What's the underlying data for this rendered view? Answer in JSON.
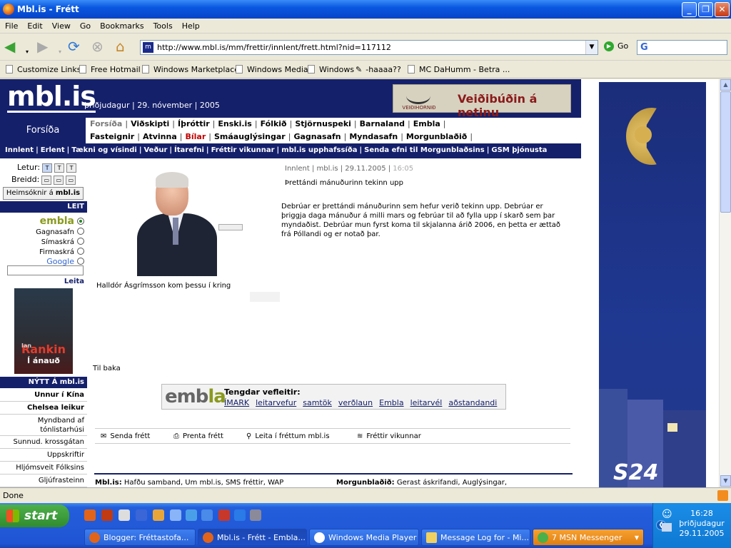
{
  "window": {
    "title": "Mbl.is - Frétt"
  },
  "menu": [
    "File",
    "Edit",
    "View",
    "Go",
    "Bookmarks",
    "Tools",
    "Help"
  ],
  "navbar": {
    "url": "http://www.mbl.is/mm/frettir/innlent/frett.html?nid=117112",
    "go": "Go"
  },
  "bookmarks": [
    "Customize Links",
    "Free Hotmail",
    "Windows Marketplace",
    "Windows Media",
    "Windows",
    "-haaaa??",
    "MC DaHumm - Betra ..."
  ],
  "site": {
    "logo": "mbl.is",
    "date": "þriðjudagur | 29. nóvember | 2005",
    "ad_text": "Veiðibúðin á netinu",
    "ad_brand": "VEIÐIHORNIÐ",
    "forsida": "Forsíða",
    "nav1": [
      "Forsíða",
      "Viðskipti",
      "Íþróttir",
      "Enski.is",
      "Fólkið",
      "Stjörnuspeki",
      "Barnaland",
      "Embla"
    ],
    "nav2": [
      "Fasteignir",
      "Atvinna",
      "Bílar",
      "Smáauglýsingar",
      "Gagnasafn",
      "Myndasafn",
      "Morgunblaðið"
    ],
    "nav3": [
      "Innlent",
      "Erlent",
      "Tækni og vísindi",
      "Veður",
      "Ítarefni",
      "Fréttir vikunnar",
      "mbl.is upphafssíða",
      "Senda efni til Morgunblaðsins",
      "GSM þjónusta"
    ]
  },
  "sidebar": {
    "letur": "Letur:",
    "breidd": "Breidd:",
    "heim_label": "Heimsóknir á",
    "heim_brand": "mbl.is",
    "leit": "LEIT",
    "search_options": [
      "embla",
      "Gagnasafn",
      "Símaskrá",
      "Firmaskrá",
      "Google"
    ],
    "leita": "Leita",
    "book_author_first": "Ian",
    "book_author": "Rankin",
    "book_title": "Í ánauð",
    "nytt": "NÝTT Á mbl.is",
    "news": [
      "Unnur í Kína",
      "Chelsea leikur",
      "Myndband af tónlistarhúsi",
      "Sunnud. krossgátan",
      "Uppskriftir",
      "Hljómsveit Fólksins",
      "Gljúfrasteinn"
    ]
  },
  "article": {
    "meta": "Innlent | mbl.is | 29.11.2005 |",
    "time": "16:05",
    "headline": "Þrettándi mánuðurinn tekinn upp",
    "body": "Debrúar er þrettándi mánuðurinn sem hefur verið tekinn upp. Debrúar er þriggja daga mánuður á milli mars og febrúar til að fylla upp í skarð sem þar myndaðist. Debrúar mun fyrst koma til skjalanna árið 2006, en þetta er ættað frá Póllandi og er notað þar.",
    "caption": "Halldór Ásgrímsson kom þessu í kring",
    "back": "Til baka"
  },
  "embla": {
    "logo_a": "emb",
    "logo_b": "la",
    "title": "Tengdar vefleitir:",
    "links": [
      "ÍMARK",
      "leitarvefur",
      "samtök",
      "verðlaun",
      "Embla",
      "leitarvél",
      "aðstandandi"
    ]
  },
  "tools": [
    "Senda frétt",
    "Prenta frétt",
    "Leita í fréttum mbl.is",
    "Fréttir vikunnar"
  ],
  "footer": {
    "a_label": "Mbl.is:",
    "a_text": "Hafðu samband, Um mbl.is, SMS fréttir, WAP",
    "b_label": "Morgunblaðið:",
    "b_text": "Gerast áskrifandi, Auglýsingar,"
  },
  "right_ad": {
    "brand": "S24"
  },
  "status": "Done",
  "taskbar": {
    "start": "start",
    "tasks": [
      "Blogger: Fréttastofa...",
      "Mbl.is - Frétt - Embla...",
      "Windows Media Player",
      "Message Log for - Mi...",
      "7 MSN Messenger"
    ],
    "time": "16:28",
    "day": "þriðjudagur",
    "date": "29.11.2005"
  }
}
